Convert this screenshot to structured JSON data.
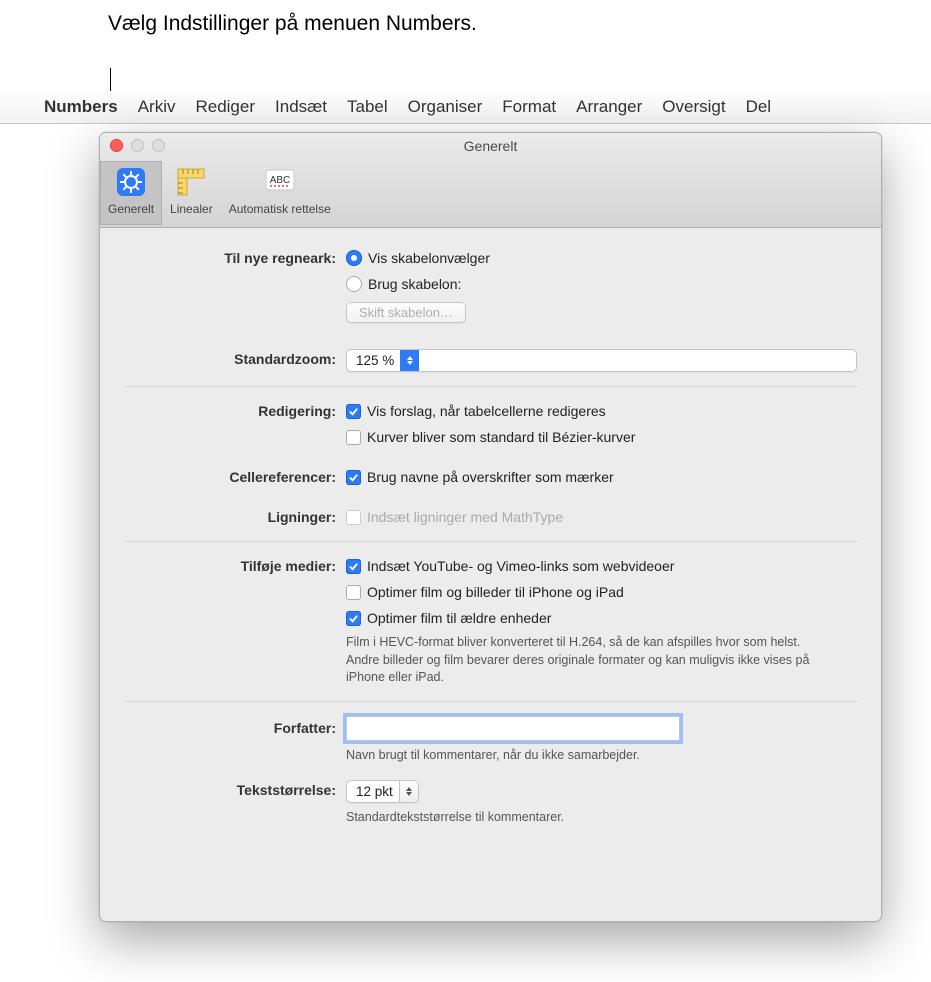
{
  "callout": "Vælg Indstillinger på menuen Numbers.",
  "menubar": {
    "items": [
      "Numbers",
      "Arkiv",
      "Rediger",
      "Indsæt",
      "Tabel",
      "Organiser",
      "Format",
      "Arranger",
      "Oversigt",
      "Del"
    ]
  },
  "window": {
    "title": "Generelt",
    "toolbar": {
      "general": "Generelt",
      "rulers": "Linealer",
      "autocorrect": "Automatisk rettelse"
    },
    "sections": {
      "new_spreadsheets": {
        "label": "Til nye regneark:",
        "radio_show": "Vis skabelonvælger",
        "radio_use": "Brug skabelon:",
        "change_btn": "Skift skabelon…"
      },
      "default_zoom": {
        "label": "Standardzoom:",
        "value": "125 %"
      },
      "editing": {
        "label": "Redigering:",
        "check_suggestions": "Vis forslag, når tabelcellerne redigeres",
        "check_bezier": "Kurver bliver som standard til Bézier-kurver"
      },
      "cell_refs": {
        "label": "Cellereferencer:",
        "check": "Brug navne på overskrifter som mærker"
      },
      "equations": {
        "label": "Ligninger:",
        "check": "Indsæt ligninger med MathType"
      },
      "add_media": {
        "label": "Tilføje medier:",
        "check_youtube": "Indsæt YouTube- og Vimeo-links som webvideoer",
        "check_optimize": "Optimer film og billeder til iPhone og iPad",
        "check_older": "Optimer film til ældre enheder",
        "desc": "Film i HEVC-format bliver konverteret til H.264, så de kan afspilles hvor som helst. Andre billeder og film bevarer deres originale formater og kan muligvis ikke vises på iPhone eller iPad."
      },
      "author": {
        "label": "Forfatter:",
        "value": "",
        "desc": "Navn brugt til kommentarer, når du ikke samarbejder."
      },
      "text_size": {
        "label": "Tekststørrelse:",
        "value": "12 pkt",
        "desc": "Standardtekststørrelse til kommentarer."
      }
    }
  }
}
